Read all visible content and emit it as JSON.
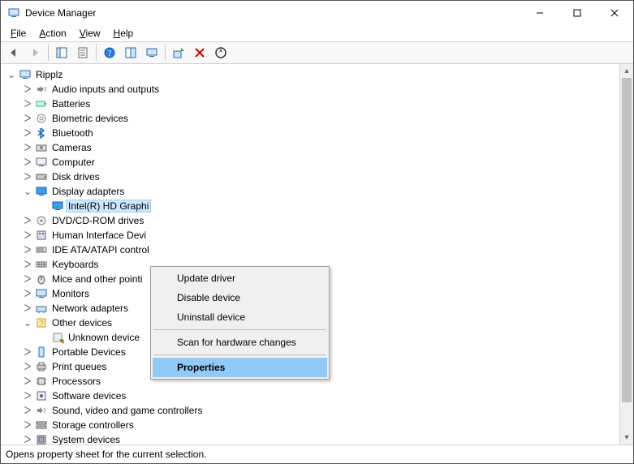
{
  "window": {
    "title": "Device Manager"
  },
  "menubar": {
    "items": [
      {
        "label": "File",
        "ul": "F"
      },
      {
        "label": "Action",
        "ul": "A"
      },
      {
        "label": "View",
        "ul": "V"
      },
      {
        "label": "Help",
        "ul": "H"
      }
    ]
  },
  "toolbar": {
    "back_name": "back-icon",
    "forward_name": "forward-icon",
    "show_hide_name": "show-hide-console-tree-icon",
    "properties_name": "properties-icon",
    "help_name": "help-icon",
    "action_center_name": "action-center-icon",
    "monitor_name": "monitor-icon",
    "update_name": "update-driver-icon",
    "uninstall_name": "uninstall-icon",
    "scan_name": "scan-hardware-icon"
  },
  "tree": {
    "root": "Ripplz",
    "items": [
      {
        "label": "Audio inputs and outputs",
        "icon": "audio",
        "expanded": false,
        "depth": 1
      },
      {
        "label": "Batteries",
        "icon": "battery",
        "expanded": false,
        "depth": 1
      },
      {
        "label": "Biometric devices",
        "icon": "biometric",
        "expanded": false,
        "depth": 1
      },
      {
        "label": "Bluetooth",
        "icon": "bluetooth",
        "expanded": false,
        "depth": 1
      },
      {
        "label": "Cameras",
        "icon": "camera",
        "expanded": false,
        "depth": 1
      },
      {
        "label": "Computer",
        "icon": "computer",
        "expanded": false,
        "depth": 1
      },
      {
        "label": "Disk drives",
        "icon": "disk",
        "expanded": false,
        "depth": 1
      },
      {
        "label": "Display adapters",
        "icon": "display",
        "expanded": true,
        "depth": 1
      },
      {
        "label": "Intel(R) HD Graphi",
        "icon": "display",
        "depth": 2,
        "selected": true,
        "leaf": true
      },
      {
        "label": "DVD/CD-ROM drives",
        "icon": "dvd",
        "expanded": false,
        "depth": 1
      },
      {
        "label": "Human Interface Devi",
        "icon": "hid",
        "expanded": false,
        "depth": 1
      },
      {
        "label": "IDE ATA/ATAPI control",
        "icon": "ide",
        "expanded": false,
        "depth": 1
      },
      {
        "label": "Keyboards",
        "icon": "keyboard",
        "expanded": false,
        "depth": 1
      },
      {
        "label": "Mice and other pointi",
        "icon": "mouse",
        "expanded": false,
        "depth": 1
      },
      {
        "label": "Monitors",
        "icon": "monitor",
        "expanded": false,
        "depth": 1
      },
      {
        "label": "Network adapters",
        "icon": "network",
        "expanded": false,
        "depth": 1
      },
      {
        "label": "Other devices",
        "icon": "other",
        "expanded": true,
        "depth": 1
      },
      {
        "label": "Unknown device",
        "icon": "unknown",
        "depth": 2,
        "leaf": true
      },
      {
        "label": "Portable Devices",
        "icon": "portable",
        "expanded": false,
        "depth": 1
      },
      {
        "label": "Print queues",
        "icon": "printer",
        "expanded": false,
        "depth": 1
      },
      {
        "label": "Processors",
        "icon": "cpu",
        "expanded": false,
        "depth": 1
      },
      {
        "label": "Software devices",
        "icon": "software",
        "expanded": false,
        "depth": 1
      },
      {
        "label": "Sound, video and game controllers",
        "icon": "sound",
        "expanded": false,
        "depth": 1
      },
      {
        "label": "Storage controllers",
        "icon": "storage",
        "expanded": false,
        "depth": 1
      },
      {
        "label": "System devices",
        "icon": "system",
        "expanded": false,
        "depth": 1
      }
    ]
  },
  "context_menu": {
    "items": [
      {
        "label": "Update driver",
        "highlight": false
      },
      {
        "label": "Disable device",
        "highlight": false
      },
      {
        "label": "Uninstall device",
        "highlight": false
      },
      {
        "sep": true
      },
      {
        "label": "Scan for hardware changes",
        "highlight": false
      },
      {
        "sep": true
      },
      {
        "label": "Properties",
        "highlight": true
      }
    ]
  },
  "statusbar": {
    "text": "Opens property sheet for the current selection."
  },
  "icons_glyph": {
    "collapsed": "ᐳ",
    "expanded": "⌄"
  }
}
